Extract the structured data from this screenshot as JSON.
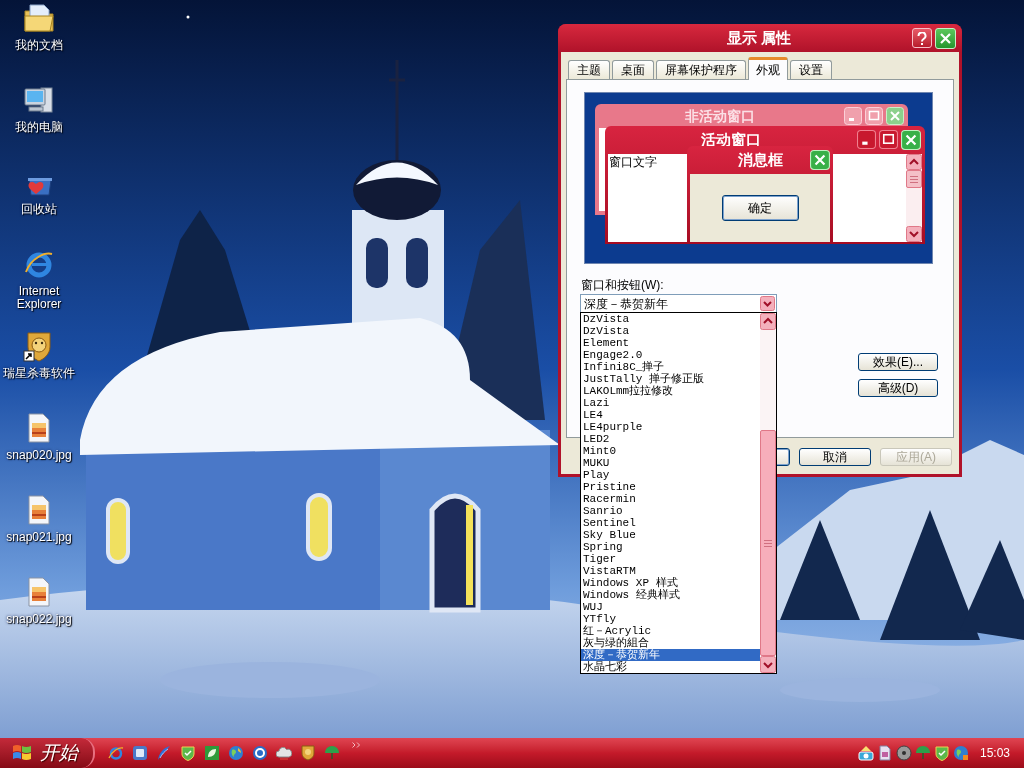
{
  "desktop": {
    "icons": [
      {
        "kind": "folder",
        "label": "我的文档"
      },
      {
        "kind": "computer",
        "label": "我的电脑"
      },
      {
        "kind": "bin",
        "label": "回收站"
      },
      {
        "kind": "browser",
        "label": "Internet Explorer"
      },
      {
        "kind": "shortcut",
        "label": "瑞星杀毒软件"
      },
      {
        "kind": "image",
        "label": "snap020.jpg"
      },
      {
        "kind": "image",
        "label": "snap021.jpg"
      },
      {
        "kind": "image",
        "label": "snap022.jpg"
      }
    ]
  },
  "dialog": {
    "title": "显示 属性",
    "tabs": [
      {
        "label": "主题",
        "selected": false
      },
      {
        "label": "桌面",
        "selected": false
      },
      {
        "label": "屏幕保护程序",
        "selected": false
      },
      {
        "label": "外观",
        "selected": true
      },
      {
        "label": "设置",
        "selected": false
      }
    ],
    "preview": {
      "inactive_window": {
        "title": "非活动窗口"
      },
      "active_window": {
        "title": "活动窗口",
        "text": "窗口文字"
      },
      "message_box": {
        "title": "消息框",
        "button": "确定"
      }
    },
    "windows_and_buttons": {
      "label": "窗口和按钮(W):",
      "value": "深度－恭贺新年",
      "expanded": true,
      "options": [
        {
          "label": "DzVista",
          "selected": false
        },
        {
          "label": "DzVista",
          "selected": false
        },
        {
          "label": "Element",
          "selected": false
        },
        {
          "label": "Engage2.0",
          "selected": false
        },
        {
          "label": "Infini8C_掸子",
          "selected": false
        },
        {
          "label": "JustTally 掸子修正版",
          "selected": false
        },
        {
          "label": "LAKOLmm拉拉修改",
          "selected": false
        },
        {
          "label": "Lazi",
          "selected": false
        },
        {
          "label": "LE4",
          "selected": false
        },
        {
          "label": "LE4purple",
          "selected": false
        },
        {
          "label": "LED2",
          "selected": false
        },
        {
          "label": "Mint0",
          "selected": false
        },
        {
          "label": "MUKU",
          "selected": false
        },
        {
          "label": "Play",
          "selected": false
        },
        {
          "label": "Pristine",
          "selected": false
        },
        {
          "label": "Racermin",
          "selected": false
        },
        {
          "label": "Sanrio",
          "selected": false
        },
        {
          "label": "Sentinel",
          "selected": false
        },
        {
          "label": "Sky Blue",
          "selected": false
        },
        {
          "label": "Spring",
          "selected": false
        },
        {
          "label": "Tiger",
          "selected": false
        },
        {
          "label": "VistaRTM",
          "selected": false
        },
        {
          "label": "Windows XP 样式",
          "selected": false
        },
        {
          "label": "Windows 经典样式",
          "selected": false
        },
        {
          "label": "WUJ",
          "selected": false
        },
        {
          "label": "YTfly",
          "selected": false
        },
        {
          "label": "红－Acrylic",
          "selected": false
        },
        {
          "label": "灰与绿的組合",
          "selected": false
        },
        {
          "label": "深度－恭贺新年",
          "selected": true
        },
        {
          "label": "水晶七彩",
          "selected": false
        }
      ]
    },
    "side_buttons": [
      {
        "label": "效果(E)..."
      },
      {
        "label": "高级(D)"
      }
    ],
    "footer_buttons": [
      {
        "kind": "default"
      },
      {
        "kind": "normal",
        "label": "取消",
        "disabled": false
      },
      {
        "kind": "normal",
        "label": "应用(A)",
        "disabled": true
      }
    ]
  },
  "taskbar": {
    "start_button": "开始",
    "clock": "15:03"
  }
}
